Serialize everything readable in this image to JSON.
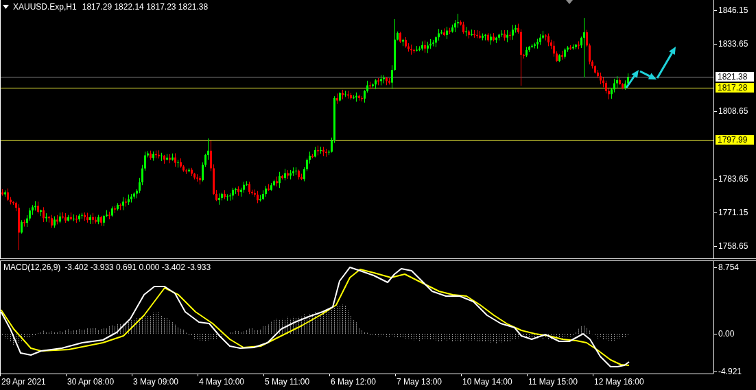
{
  "chart": {
    "symbol": "XAUUSD.Exp,H1",
    "ohlc": "1817.29 1822.14 1817.23 1821.38",
    "price_axis": [
      "1846.15",
      "1833.65",
      "1808.65",
      "1783.65",
      "1771.15",
      "1758.65"
    ],
    "price_lines": [
      {
        "label": "1821.38",
        "kind": "bid"
      },
      {
        "label": "1817.28",
        "kind": "level"
      },
      {
        "label": "1797.99",
        "kind": "level"
      }
    ]
  },
  "indicator": {
    "name": "MACD(12,26,9)",
    "values": "-3.402 -3.933 0.691 0.000 -3.402 -3.933",
    "axis": [
      "8.754",
      "0.00",
      "-4.921"
    ]
  },
  "time_axis": [
    "29 Apr 2021",
    "30 Apr 08:00",
    "3 May 09:00",
    "4 May 10:00",
    "5 May 11:00",
    "6 May 12:00",
    "7 May 13:00",
    "10 May 14:00",
    "11 May 15:00",
    "12 May 16:00"
  ]
}
